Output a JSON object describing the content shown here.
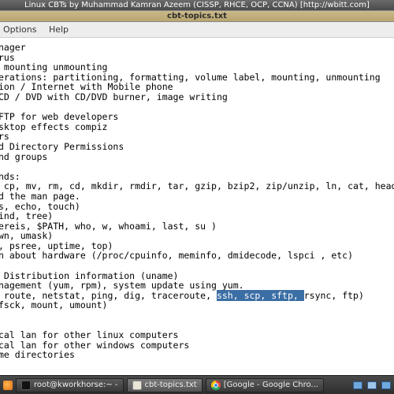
{
  "window": {
    "outer_title": "Linux CBTs by Muhammad Kamran Azeem (CISSP, RHCE, OCP, CCNA) [http://wbitt.com]",
    "inner_title": "cbt-topics.txt"
  },
  "menubar": {
    "items": [
      "Options",
      "Help"
    ]
  },
  "editor": {
    "pre_selection": "nager\nrus\n mounting unmounting\nerations: partitioning, formatting, volume label, mounting, unmounting\nion / Internet with Mobile phone\nCD / DVD with CD/DVD burner, image writing\n\nFTP for web developers\nsktop effects compiz\nrs\nd Directory Permissions\nnd groups\n\nnds:\n cp, mv, rm, cd, mkdir, rmdir, tar, gzip, bzip2, zip/unzip, ln, cat, head, tai\nd the man page.\ns, echo, touch)\nind, tree)\nereis, $PATH, who, w, whoami, last, su )\nwn, umask)\n, psree, uptime, top)\nn about hardware (/proc/cpuinfo, meminfo, dmidecode, lspci , etc)\n\n Distribution information (uname)\nnagement (yum, rpm), system update using yum.\n route, netstat, ping, dig, traceroute, ",
    "selection": "ssh, scp, sftp, ",
    "post_selection": "rsync, ftp)\nfsck, mount, umount)\n\n\ncal lan for other linux computers\ncal lan for other windows computers\nme directories "
  },
  "taskbar": {
    "items": [
      {
        "label": "root@kworkhorse:~ -",
        "icon": "term",
        "active": false
      },
      {
        "label": "cbt-topics.txt",
        "icon": "gedit",
        "active": true
      },
      {
        "label": "[Google - Google Chro...",
        "icon": "chrome",
        "active": false
      }
    ]
  }
}
